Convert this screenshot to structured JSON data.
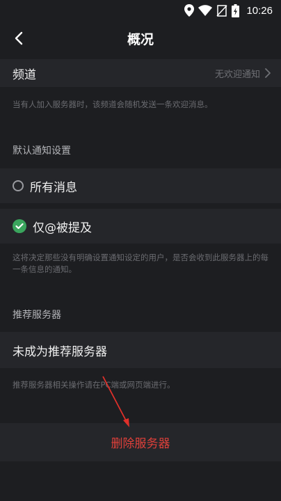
{
  "status_bar": {
    "time": "10:26",
    "icons": [
      "location-icon",
      "wifi-icon",
      "no-sim-icon",
      "battery-charging-icon"
    ]
  },
  "header": {
    "title": "概况",
    "back_icon": "chevron-left-icon"
  },
  "channel": {
    "label": "频道",
    "value": "无欢迎通知",
    "chevron_icon": "chevron-right-icon",
    "hint": "当有人加入服务器时，该频道会随机发送一条欢迎消息。"
  },
  "notification": {
    "section_title": "默认通知设置",
    "options": [
      {
        "label": "所有消息",
        "selected": false
      },
      {
        "label": "仅@被提及",
        "selected": true
      }
    ],
    "hint": "这将决定那些没有明确设置通知设定的用户，是否会收到此服务器上的每一条信息的通知。"
  },
  "recommend": {
    "section_title": "推荐服务器",
    "label": "未成为推荐服务器",
    "hint": "推荐服务器相关操作请在PC端或网页端进行。"
  },
  "delete": {
    "label": "删除服务器",
    "color": "#e0403a"
  },
  "colors": {
    "background": "#1d1e21",
    "row_background": "#25262a",
    "check_green": "#3aa55d",
    "annotation_arrow": "#e0302a"
  }
}
